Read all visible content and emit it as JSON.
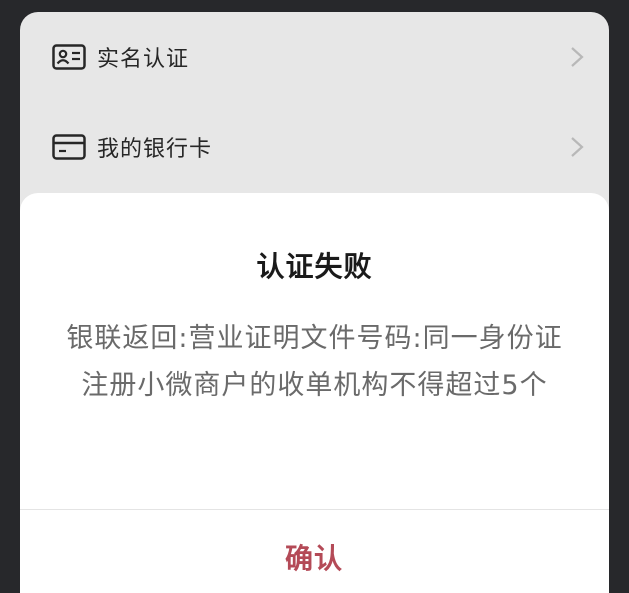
{
  "list": {
    "items": [
      {
        "label": "实名认证",
        "icon": "id-card-icon"
      },
      {
        "label": "我的银行卡",
        "icon": "bank-card-icon"
      }
    ]
  },
  "dialog": {
    "title": "认证失败",
    "message": "银联返回:营业证明文件号码:同一身份证注册小微商户的收单机构不得超过5个",
    "confirm_label": "确认"
  },
  "colors": {
    "confirm_text": "#b44a57",
    "title_text": "#1a1a1a",
    "message_text": "#6a6a6a"
  }
}
